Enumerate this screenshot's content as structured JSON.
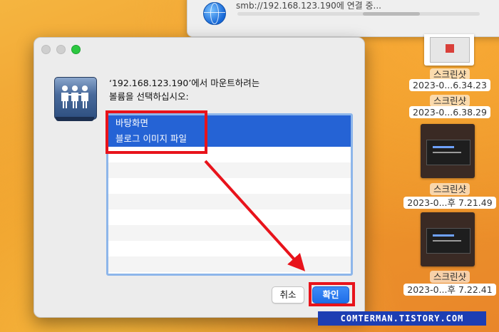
{
  "connection": {
    "url_text": "smb://192.168.123.190에 연결 중..."
  },
  "desktop": {
    "items": [
      {
        "name": "스크린샷",
        "date": "2023-0...6.34.23"
      },
      {
        "name": "스크린샷",
        "date": "2023-0...6.38.29"
      },
      {
        "name": "스크린샷",
        "date": "2023-0...후 7.21.49"
      },
      {
        "name": "스크린샷",
        "date": "2023-0...후 7.22.41"
      }
    ]
  },
  "dialog": {
    "message_line1": "‘192.168.123.190’에서 마운트하려는",
    "message_line2": "볼륨을 선택하십시오:",
    "volumes": [
      "바탕화면",
      "블로그 이미지 파일"
    ],
    "cancel_label": "취소",
    "ok_label": "확인"
  },
  "watermark": "COMTERMAN.TISTORY.COM",
  "colors": {
    "selection": "#2563d5",
    "highlight_red": "#e8131b",
    "ok_button": "#1f6ee8"
  }
}
